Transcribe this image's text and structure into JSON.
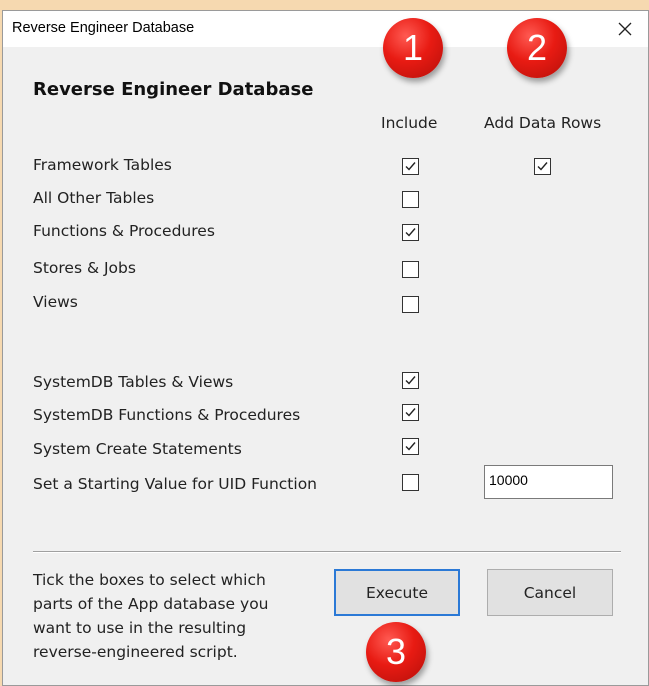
{
  "window": {
    "title": "Reverse Engineer Database"
  },
  "form": {
    "heading": "Reverse Engineer Database",
    "columns": {
      "include": "Include",
      "add_data_rows": "Add Data Rows"
    },
    "rows": [
      {
        "label": "Framework Tables",
        "include": true,
        "add_data_rows": true
      },
      {
        "label": "All Other Tables",
        "include": false
      },
      {
        "label": "Functions & Procedures",
        "include": true
      },
      {
        "label": "Stores & Jobs",
        "include": false
      },
      {
        "label": "Views",
        "include": false
      },
      {
        "label": "SystemDB Tables & Views",
        "include": true
      },
      {
        "label": "SystemDB Functions & Procedures",
        "include": true
      },
      {
        "label": "System Create Statements",
        "include": true
      },
      {
        "label": "Set a Starting Value for UID Function",
        "include": false
      }
    ],
    "uid_start_value": "10000"
  },
  "footer": {
    "description_lines": [
      "Tick the boxes to select which",
      "parts of the App database you",
      "want to use in the resulting",
      "reverse-engineered script."
    ],
    "execute_label": "Execute",
    "cancel_label": "Cancel"
  },
  "markers": [
    "1",
    "2",
    "3"
  ],
  "colors": {
    "marker_red": "#e81b13",
    "default_button_border": "#2b79d6"
  }
}
